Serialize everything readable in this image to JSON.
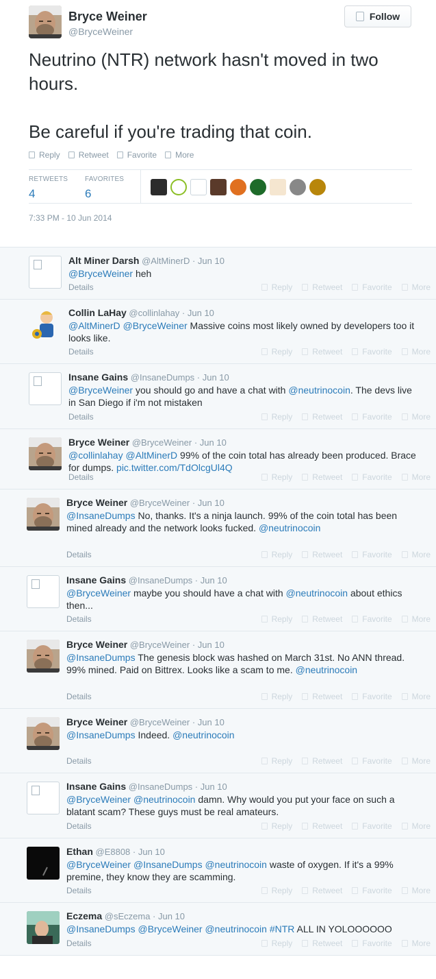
{
  "header": {
    "name": "Bryce Weiner",
    "handle": "@BryceWeiner",
    "follow_label": "Follow"
  },
  "tweet": {
    "paragraphs": [
      "Neutrino (NTR) network hasn't moved in two hours.",
      "Be careful if you're trading that coin."
    ],
    "actions": [
      "Reply",
      "Retweet",
      "Favorite",
      "More"
    ],
    "retweets_label": "RETWEETS",
    "retweets": "4",
    "favorites_label": "FAVORITES",
    "favorites": "6",
    "timestamp": "7:33 PM - 10 Jun 2014"
  },
  "replies": [
    {
      "name": "Alt Miner Darsh",
      "handle": "@AltMinerD",
      "date": "Jun 10",
      "avatar": "blank",
      "segments": [
        {
          "t": "@BryceWeiner",
          "m": true
        },
        {
          "t": " heh",
          "m": false
        }
      ],
      "details": "Details"
    },
    {
      "name": "Collin LaHay",
      "handle": "@collinlahay",
      "date": "Jun 10",
      "avatar": "vault",
      "segments": [
        {
          "t": "@AltMinerD",
          "m": true
        },
        {
          "t": " ",
          "m": false
        },
        {
          "t": "@BryceWeiner",
          "m": true
        },
        {
          "t": " Massive coins most likely owned by developers too it looks like.",
          "m": false
        }
      ],
      "details": "Details"
    },
    {
      "name": "Insane Gains",
      "handle": "@InsaneDumps",
      "date": "Jun 10",
      "avatar": "blank",
      "segments": [
        {
          "t": "@BryceWeiner",
          "m": true
        },
        {
          "t": " you should go and have a chat with ",
          "m": false
        },
        {
          "t": "@neutrinocoin",
          "m": true
        },
        {
          "t": ". The devs live in San Diego if i'm not mistaken",
          "m": false
        }
      ],
      "details": "Details"
    },
    {
      "name": "Bryce Weiner",
      "handle": "@BryceWeiner",
      "date": "Jun 10",
      "avatar": "bryce",
      "segments": [
        {
          "t": "@collinlahay",
          "m": true
        },
        {
          "t": " ",
          "m": false
        },
        {
          "t": "@AltMinerD",
          "m": true
        },
        {
          "t": " 99% of the coin total has already been produced. Brace for dumps. ",
          "m": false
        },
        {
          "t": "pic.twitter.com/TdOlcgUl4Q",
          "m": true
        }
      ],
      "details": "Details"
    },
    {
      "name": "Bryce Weiner",
      "handle": "@BryceWeiner",
      "date": "Jun 10",
      "avatar": "bryce",
      "segments": [
        {
          "t": "@InsaneDumps",
          "m": true
        },
        {
          "t": " No, thanks.  It's a ninja launch. 99% of the coin total has been mined already and the network looks fucked. ",
          "m": false
        },
        {
          "t": "@neutrinocoin",
          "m": true
        }
      ],
      "details": "Details"
    },
    {
      "name": "Insane Gains",
      "handle": "@InsaneDumps",
      "date": "Jun 10",
      "avatar": "blank",
      "segments": [
        {
          "t": "@BryceWeiner",
          "m": true
        },
        {
          "t": " maybe you should have a chat with ",
          "m": false
        },
        {
          "t": "@neutrinocoin",
          "m": true
        },
        {
          "t": " about ethics then...",
          "m": false
        }
      ],
      "details": "Details"
    },
    {
      "name": "Bryce Weiner",
      "handle": "@BryceWeiner",
      "date": "Jun 10",
      "avatar": "bryce",
      "segments": [
        {
          "t": "@InsaneDumps",
          "m": true
        },
        {
          "t": " The genesis block was hashed on March 31st. No ANN thread. 99% mined. Paid on Bittrex.  Looks like a scam to me. ",
          "m": false
        },
        {
          "t": "@neutrinocoin",
          "m": true
        }
      ],
      "details": "Details"
    },
    {
      "name": "Bryce Weiner",
      "handle": "@BryceWeiner",
      "date": "Jun 10",
      "avatar": "bryce",
      "segments": [
        {
          "t": "@InsaneDumps",
          "m": true
        },
        {
          "t": " Indeed. ",
          "m": false
        },
        {
          "t": "@neutrinocoin",
          "m": true
        }
      ],
      "details": "Details"
    },
    {
      "name": "Insane Gains",
      "handle": "@InsaneDumps",
      "date": "Jun 10",
      "avatar": "blank",
      "segments": [
        {
          "t": "@BryceWeiner",
          "m": true
        },
        {
          "t": " ",
          "m": false
        },
        {
          "t": "@neutrinocoin",
          "m": true
        },
        {
          "t": " damn. Why would you put your face on such a blatant scam? These guys must be real amateurs.",
          "m": false
        }
      ],
      "details": "Details"
    },
    {
      "name": "Ethan",
      "handle": "@E8808",
      "date": "Jun 10",
      "avatar": "dark",
      "segments": [
        {
          "t": "@BryceWeiner",
          "m": true
        },
        {
          "t": " ",
          "m": false
        },
        {
          "t": "@InsaneDumps",
          "m": true
        },
        {
          "t": " ",
          "m": false
        },
        {
          "t": "@neutrinocoin",
          "m": true
        },
        {
          "t": " waste of oxygen. If it's a 99% premine, they know they are scamming.",
          "m": false
        }
      ],
      "details": "Details"
    },
    {
      "name": "Eczema",
      "handle": "@sEczema",
      "date": "Jun 10",
      "avatar": "eczema",
      "segments": [
        {
          "t": "@InsaneDumps",
          "m": true
        },
        {
          "t": " ",
          "m": false
        },
        {
          "t": "@BryceWeiner",
          "m": true
        },
        {
          "t": " ",
          "m": false
        },
        {
          "t": "@neutrinocoin",
          "m": true
        },
        {
          "t": " ",
          "m": false
        },
        {
          "t": "#NTR",
          "m": true
        },
        {
          "t": " ALL IN YOLOOOOOO",
          "m": false
        }
      ],
      "details": "Details"
    }
  ],
  "reply_actions": [
    "Reply",
    "Retweet",
    "Favorite",
    "More"
  ]
}
